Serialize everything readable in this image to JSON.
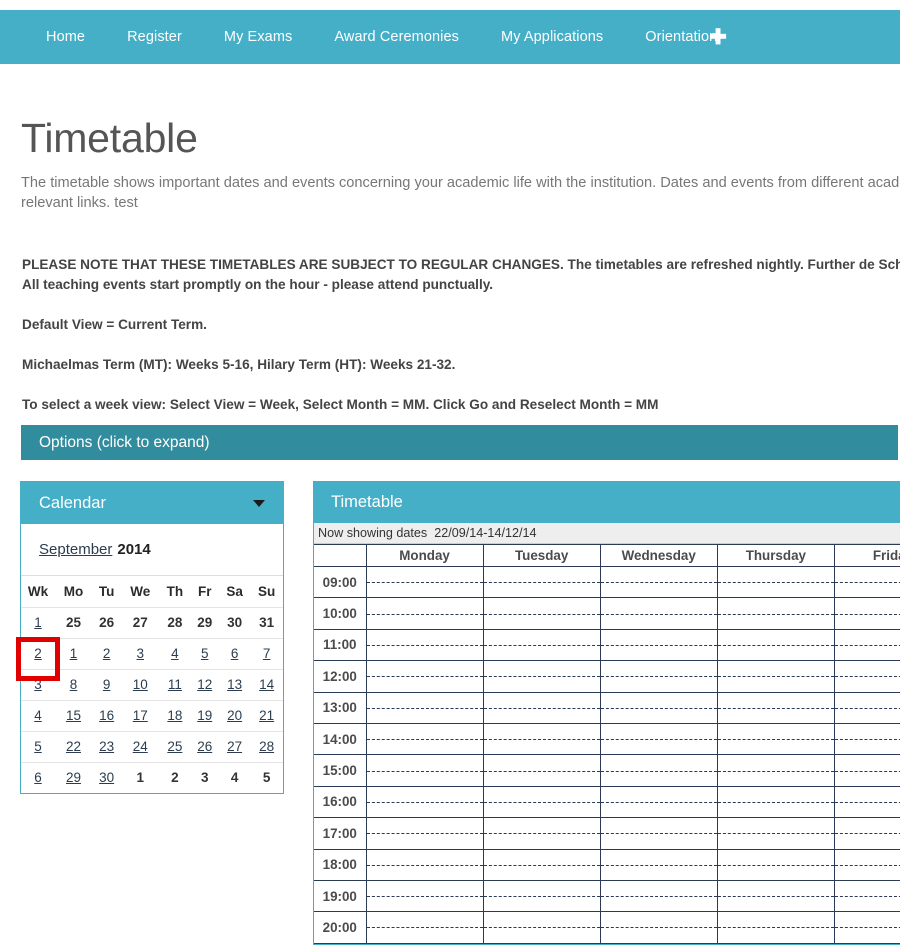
{
  "nav": {
    "items": [
      {
        "label": "Home"
      },
      {
        "label": "Register"
      },
      {
        "label": "My Exams"
      },
      {
        "label": "Award Ceremonies"
      },
      {
        "label": "My Applications"
      },
      {
        "label": "Orientation"
      }
    ],
    "add_icon": "✚",
    "background_color": "#45AFC8"
  },
  "page": {
    "title": "Timetable",
    "intro": "The timetable shows important dates and events concerning your academic life with the institution. Dates and events from different academic w relevant links. test",
    "notices": [
      "PLEASE NOTE THAT THESE TIMETABLES ARE SUBJECT TO REGULAR CHANGES. The timetables are refreshed nightly. Further de School or Course Office. All teaching events start promptly on the hour - please attend punctually.",
      "Default View = Current Term.",
      "Michaelmas Term (MT): Weeks 5-16, Hilary Term (HT): Weeks 21-32.",
      "To select a week view: Select View = Week, Select Month = MM. Click Go and Reselect Month = MM"
    ]
  },
  "options": {
    "label": "Options (click to expand)",
    "background_color": "#318D9E"
  },
  "calendar": {
    "title": "Calendar",
    "collapse_icon": "chevron-down-icon",
    "month": "September",
    "year": "2014",
    "headers": [
      "Wk",
      "Mo",
      "Tu",
      "We",
      "Th",
      "Fr",
      "Sa",
      "Su"
    ],
    "highlight_color": "#e00000",
    "highlighted_week": "2",
    "rows": [
      {
        "wk": "1",
        "wk_link": true,
        "days": [
          {
            "n": "25",
            "link": false
          },
          {
            "n": "26",
            "link": false
          },
          {
            "n": "27",
            "link": false
          },
          {
            "n": "28",
            "link": false
          },
          {
            "n": "29",
            "link": false
          },
          {
            "n": "30",
            "link": false
          },
          {
            "n": "31",
            "link": false
          }
        ]
      },
      {
        "wk": "2",
        "wk_link": true,
        "marked": true,
        "days": [
          {
            "n": "1",
            "link": true
          },
          {
            "n": "2",
            "link": true
          },
          {
            "n": "3",
            "link": true
          },
          {
            "n": "4",
            "link": true
          },
          {
            "n": "5",
            "link": true
          },
          {
            "n": "6",
            "link": true
          },
          {
            "n": "7",
            "link": true
          }
        ]
      },
      {
        "wk": "3",
        "wk_link": true,
        "days": [
          {
            "n": "8",
            "link": true
          },
          {
            "n": "9",
            "link": true
          },
          {
            "n": "10",
            "link": true
          },
          {
            "n": "11",
            "link": true
          },
          {
            "n": "12",
            "link": true
          },
          {
            "n": "13",
            "link": true
          },
          {
            "n": "14",
            "link": true
          }
        ]
      },
      {
        "wk": "4",
        "wk_link": true,
        "days": [
          {
            "n": "15",
            "link": true
          },
          {
            "n": "16",
            "link": true
          },
          {
            "n": "17",
            "link": true
          },
          {
            "n": "18",
            "link": true
          },
          {
            "n": "19",
            "link": true
          },
          {
            "n": "20",
            "link": true
          },
          {
            "n": "21",
            "link": true
          }
        ]
      },
      {
        "wk": "5",
        "wk_link": true,
        "days": [
          {
            "n": "22",
            "link": true
          },
          {
            "n": "23",
            "link": true
          },
          {
            "n": "24",
            "link": true
          },
          {
            "n": "25",
            "link": true
          },
          {
            "n": "26",
            "link": true
          },
          {
            "n": "27",
            "link": true
          },
          {
            "n": "28",
            "link": true
          }
        ]
      },
      {
        "wk": "6",
        "wk_link": true,
        "days": [
          {
            "n": "29",
            "link": true
          },
          {
            "n": "30",
            "link": true
          },
          {
            "n": "1",
            "link": false
          },
          {
            "n": "2",
            "link": false
          },
          {
            "n": "3",
            "link": false
          },
          {
            "n": "4",
            "link": false
          },
          {
            "n": "5",
            "link": false
          }
        ]
      }
    ]
  },
  "timetable": {
    "title": "Timetable",
    "showing_label": "Now showing dates",
    "showing_range": "22/09/14-14/12/14",
    "day_headers": [
      "",
      "Monday",
      "Tuesday",
      "Wednesday",
      "Thursday",
      "Friday"
    ],
    "times": [
      "09:00",
      "10:00",
      "11:00",
      "12:00",
      "13:00",
      "14:00",
      "15:00",
      "16:00",
      "17:00",
      "18:00",
      "19:00",
      "20:00"
    ]
  }
}
